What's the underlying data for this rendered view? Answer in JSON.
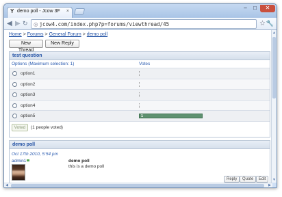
{
  "browser": {
    "tab_title": "demo poll - Jcow 3F",
    "tab_favicon": "Y",
    "url": "jcow4.com/index.php?p=forums/viewthread/45",
    "controls": {
      "minimize": "–",
      "maximize": "□",
      "close": "✕"
    },
    "icons": {
      "back": "◀",
      "forward": "▶",
      "reload": "↻",
      "globe": "◎",
      "star": "☆",
      "wrench": "🔧",
      "tab_close": "×"
    }
  },
  "breadcrumb": [
    {
      "label": "Home"
    },
    {
      "label": "Forums"
    },
    {
      "label": "General Forum"
    },
    {
      "label": "demo poll"
    }
  ],
  "breadcrumb_sep": ">",
  "actions": {
    "new_thread": "New Thread",
    "new_reply": "New Reply"
  },
  "poll": {
    "title": "test question",
    "options_header": "Options (Maximum selection: 1)",
    "votes_header": "Votes",
    "options": [
      {
        "label": "option1",
        "votes": 0
      },
      {
        "label": "option2",
        "votes": 0
      },
      {
        "label": "option3",
        "votes": 0
      },
      {
        "label": "option4",
        "votes": 0
      },
      {
        "label": "option5",
        "votes": 1
      }
    ],
    "total_votes": 1,
    "voted_button": "Voted",
    "voted_text": "(1 people voted)",
    "bar_color": "#5e9170"
  },
  "post": {
    "thread_title": "demo poll",
    "date": "Oct 17th 2010, 5:54 pm",
    "username": "admin1",
    "subject": "demo poll",
    "body": "this is a demo poll",
    "buttons": {
      "reply": "Reply",
      "quote": "Quote",
      "edit": "Edit"
    }
  }
}
